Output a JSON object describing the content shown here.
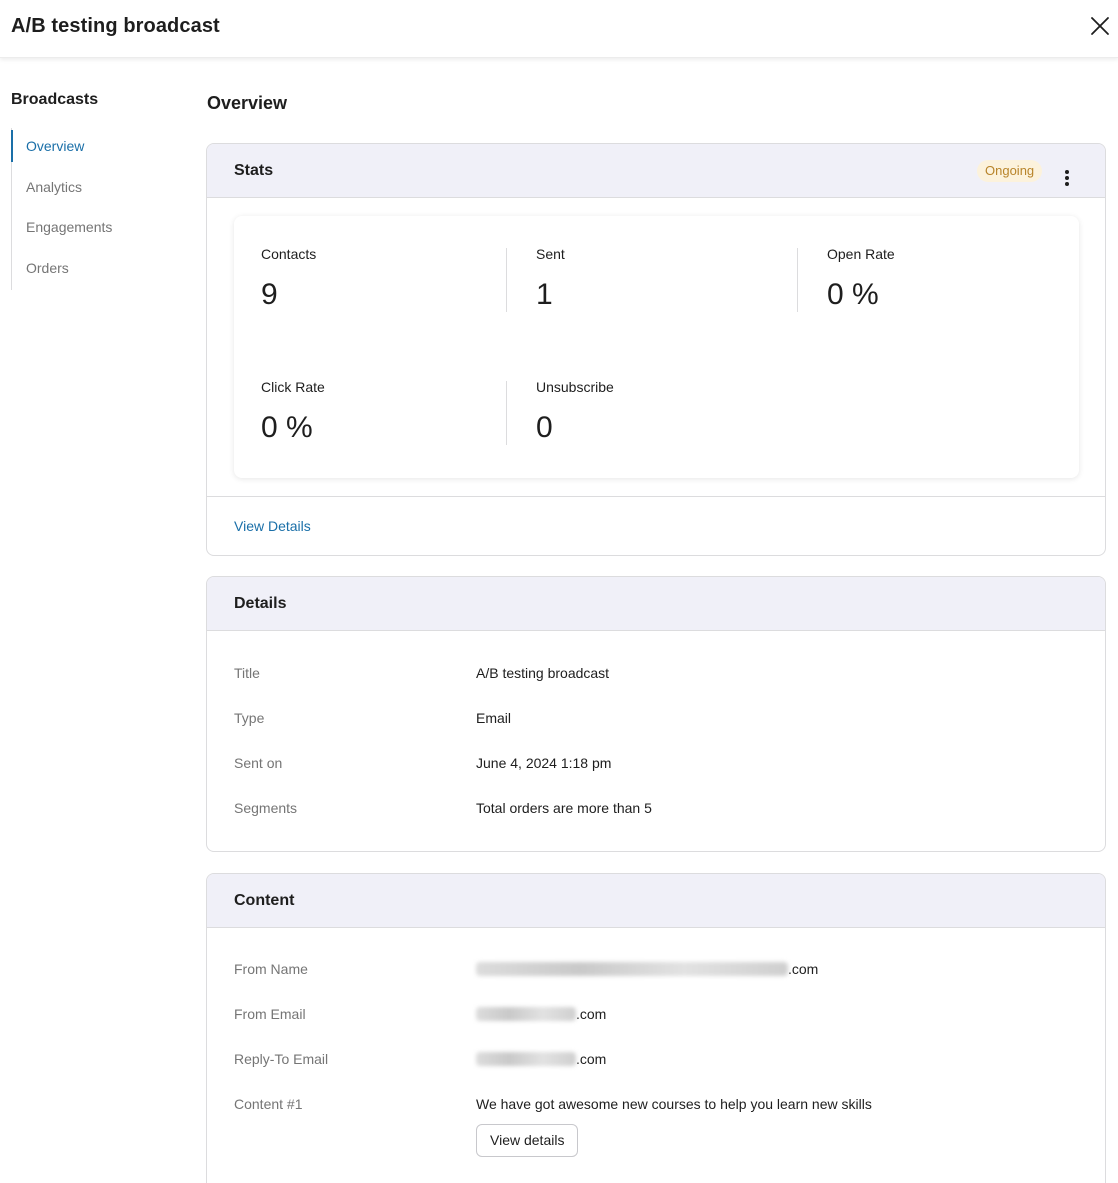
{
  "header": {
    "title": "A/B testing broadcast",
    "close_icon": "close-icon"
  },
  "sidebar": {
    "title": "Broadcasts",
    "items": [
      {
        "label": "Overview",
        "active": true
      },
      {
        "label": "Analytics",
        "active": false
      },
      {
        "label": "Engagements",
        "active": false
      },
      {
        "label": "Orders",
        "active": false
      }
    ]
  },
  "main": {
    "title": "Overview"
  },
  "stats": {
    "title": "Stats",
    "status": "Ongoing",
    "items": [
      {
        "label": "Contacts",
        "value": "9"
      },
      {
        "label": "Sent",
        "value": "1"
      },
      {
        "label": "Open Rate",
        "value": "0 %"
      },
      {
        "label": "Click Rate",
        "value": "0 %"
      },
      {
        "label": "Unsubscribe",
        "value": "0"
      }
    ],
    "view_details": "View Details"
  },
  "details": {
    "title": "Details",
    "rows": [
      {
        "key": "Title",
        "value": "A/B testing broadcast"
      },
      {
        "key": "Type",
        "value": "Email"
      },
      {
        "key": "Sent on",
        "value": "June 4, 2024 1:18 pm"
      },
      {
        "key": "Segments",
        "value": "Total orders are more than 5"
      }
    ]
  },
  "content": {
    "title": "Content",
    "rows": [
      {
        "key": "From Name",
        "value_suffix": ".com"
      },
      {
        "key": "From Email",
        "value_suffix": ".com"
      },
      {
        "key": "Reply-To Email",
        "value_suffix": ".com"
      },
      {
        "key": "Content #1",
        "value": "We have got awesome new courses to help you learn new skills"
      }
    ],
    "view_details_button": "View details"
  },
  "colors": {
    "accent": "#1a6fa8",
    "badge_bg": "#fcf2dc",
    "badge_text": "#b8842a",
    "card_header_bg": "#f0f0f8"
  }
}
